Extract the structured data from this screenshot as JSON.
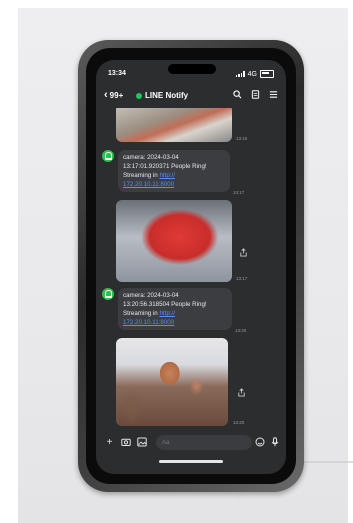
{
  "status_bar": {
    "time": "13:34",
    "network": "4G"
  },
  "header": {
    "back_label": "99+",
    "chat_title": "LINE Notify"
  },
  "messages": [
    {
      "text_line1": "camera: 2024-03-04",
      "text_line2": "13:17:01.920371 People Ring!",
      "text_line3": "Streaming in",
      "link1": "http://",
      "link2": "172.20.10.11:8000",
      "time": "13:17"
    },
    {
      "text_line1": "camera: 2024-03-04",
      "text_line2": "13:20:56.318504 People Ring!",
      "text_line3": "Streaming in",
      "link1": "http://",
      "link2": "172.20.10.11:8000",
      "time": "13:20"
    }
  ],
  "image_times": {
    "first": "13:16",
    "second": "13:17",
    "third": "13:20"
  },
  "composer": {
    "placeholder": "Aa"
  },
  "colors": {
    "line_green": "#2fbf4f",
    "bubble": "#3b3d40",
    "link": "#5b8dff",
    "screen_bg": "#2b2d2f"
  }
}
